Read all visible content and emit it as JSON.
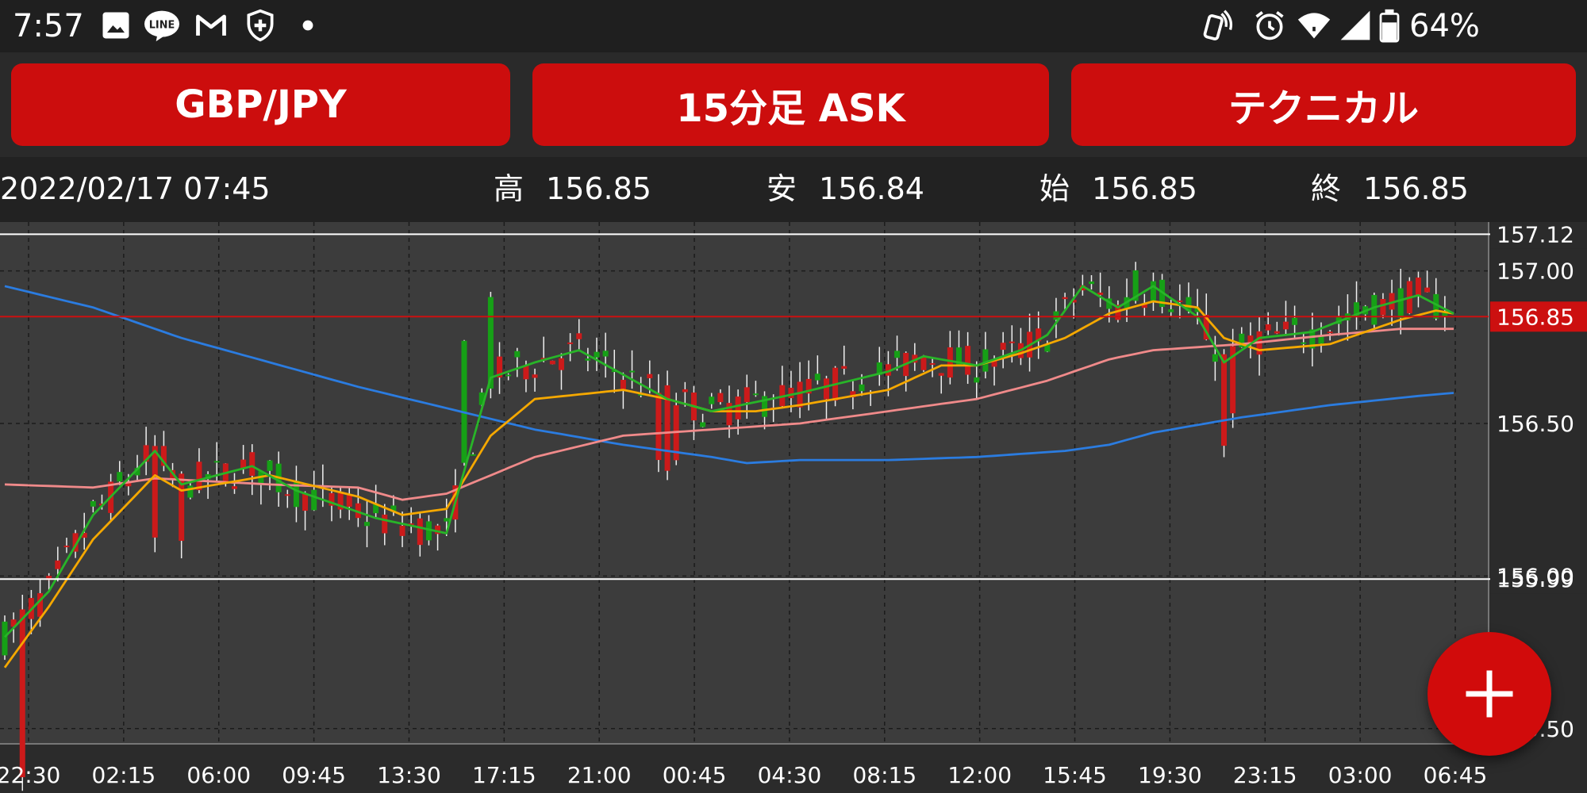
{
  "status_bar": {
    "time": "7:57",
    "left_icons": [
      "image-icon",
      "line-app-icon",
      "gmail-icon",
      "shield-plus-icon",
      "dot-icon"
    ],
    "right_icons": [
      "nfc-icon",
      "alarm-icon",
      "wifi-icon",
      "signal-icon",
      "battery-icon"
    ],
    "battery_percent": "64%"
  },
  "toolbar": {
    "pair_label": "GBP/JPY",
    "timeframe_label": "15分足 ASK",
    "technical_label": "テクニカル",
    "button_color": "#cc0d0d"
  },
  "info": {
    "datetime": "2022/02/17 07:45",
    "high_label": "高",
    "high_value": "156.85",
    "low_label": "安",
    "low_value": "156.84",
    "open_label": "始",
    "open_value": "156.85",
    "close_label": "終",
    "close_value": "156.85"
  },
  "chart_data": {
    "type": "candlestick",
    "y_ticks": [
      "157.00",
      "156.50",
      "156.00",
      "155.50"
    ],
    "y_range": [
      155.45,
      157.16
    ],
    "x_ticks": [
      "22:30",
      "02:15",
      "06:00",
      "09:45",
      "13:30",
      "17:15",
      "21:00",
      "00:45",
      "04:30",
      "08:15",
      "12:00",
      "15:45",
      "19:30",
      "23:15",
      "03:00",
      "06:45"
    ],
    "current_price": "156.85",
    "range_high": "157.12",
    "range_low": "155.99",
    "colors": {
      "up": "#16a016",
      "down": "#cc1a1a",
      "wick": "#eeeeee",
      "ma_short": "#28b428",
      "ma_mid": "#f5a800",
      "ma_long": "#f08a8a",
      "ma_200": "#2b7ce0",
      "current_line": "#cc1010",
      "range_line": "#ffffff",
      "background": "#3c3c3c"
    },
    "ma_200": [
      [
        0,
        156.95
      ],
      [
        10,
        156.88
      ],
      [
        20,
        156.78
      ],
      [
        30,
        156.7
      ],
      [
        40,
        156.62
      ],
      [
        50,
        156.55
      ],
      [
        60,
        156.48
      ],
      [
        70,
        156.43
      ],
      [
        80,
        156.39
      ],
      [
        84,
        156.37
      ],
      [
        90,
        156.38
      ],
      [
        100,
        156.38
      ],
      [
        110,
        156.39
      ],
      [
        120,
        156.41
      ],
      [
        125,
        156.43
      ],
      [
        130,
        156.47
      ],
      [
        140,
        156.52
      ],
      [
        150,
        156.56
      ],
      [
        160,
        156.59
      ],
      [
        164,
        156.6
      ]
    ],
    "ma_long": [
      [
        0,
        156.3
      ],
      [
        10,
        156.29
      ],
      [
        17,
        156.32
      ],
      [
        30,
        156.3
      ],
      [
        40,
        156.29
      ],
      [
        45,
        156.25
      ],
      [
        50,
        156.27
      ],
      [
        60,
        156.39
      ],
      [
        70,
        156.46
      ],
      [
        80,
        156.48
      ],
      [
        90,
        156.5
      ],
      [
        100,
        156.54
      ],
      [
        110,
        156.58
      ],
      [
        118,
        156.64
      ],
      [
        125,
        156.71
      ],
      [
        130,
        156.74
      ],
      [
        140,
        156.76
      ],
      [
        150,
        156.79
      ],
      [
        158,
        156.81
      ],
      [
        164,
        156.81
      ]
    ],
    "ma_mid": [
      [
        0,
        155.7
      ],
      [
        5,
        155.9
      ],
      [
        10,
        156.12
      ],
      [
        17,
        156.33
      ],
      [
        20,
        156.28
      ],
      [
        30,
        156.33
      ],
      [
        40,
        156.26
      ],
      [
        45,
        156.2
      ],
      [
        50,
        156.22
      ],
      [
        55,
        156.46
      ],
      [
        60,
        156.58
      ],
      [
        70,
        156.61
      ],
      [
        75,
        156.58
      ],
      [
        80,
        156.54
      ],
      [
        85,
        156.54
      ],
      [
        90,
        156.56
      ],
      [
        100,
        156.61
      ],
      [
        106,
        156.69
      ],
      [
        110,
        156.69
      ],
      [
        115,
        156.73
      ],
      [
        120,
        156.78
      ],
      [
        125,
        156.86
      ],
      [
        130,
        156.9
      ],
      [
        135,
        156.88
      ],
      [
        138,
        156.78
      ],
      [
        142,
        156.74
      ],
      [
        150,
        156.76
      ],
      [
        158,
        156.84
      ],
      [
        162,
        156.87
      ],
      [
        164,
        156.86
      ]
    ],
    "ma_short": [
      [
        0,
        155.8
      ],
      [
        5,
        155.95
      ],
      [
        10,
        156.2
      ],
      [
        17,
        156.41
      ],
      [
        20,
        156.3
      ],
      [
        28,
        156.36
      ],
      [
        33,
        156.28
      ],
      [
        42,
        156.19
      ],
      [
        50,
        156.14
      ],
      [
        55,
        156.65
      ],
      [
        60,
        156.7
      ],
      [
        65,
        156.74
      ],
      [
        70,
        156.66
      ],
      [
        75,
        156.58
      ],
      [
        80,
        156.54
      ],
      [
        90,
        156.6
      ],
      [
        100,
        156.67
      ],
      [
        104,
        156.72
      ],
      [
        110,
        156.69
      ],
      [
        115,
        156.74
      ],
      [
        118,
        156.79
      ],
      [
        122,
        156.95
      ],
      [
        126,
        156.88
      ],
      [
        130,
        156.95
      ],
      [
        135,
        156.85
      ],
      [
        138,
        156.7
      ],
      [
        142,
        156.78
      ],
      [
        148,
        156.8
      ],
      [
        155,
        156.88
      ],
      [
        160,
        156.92
      ],
      [
        164,
        156.86
      ]
    ]
  },
  "fab": {
    "icon": "plus-icon",
    "color": "#d10b0b"
  }
}
